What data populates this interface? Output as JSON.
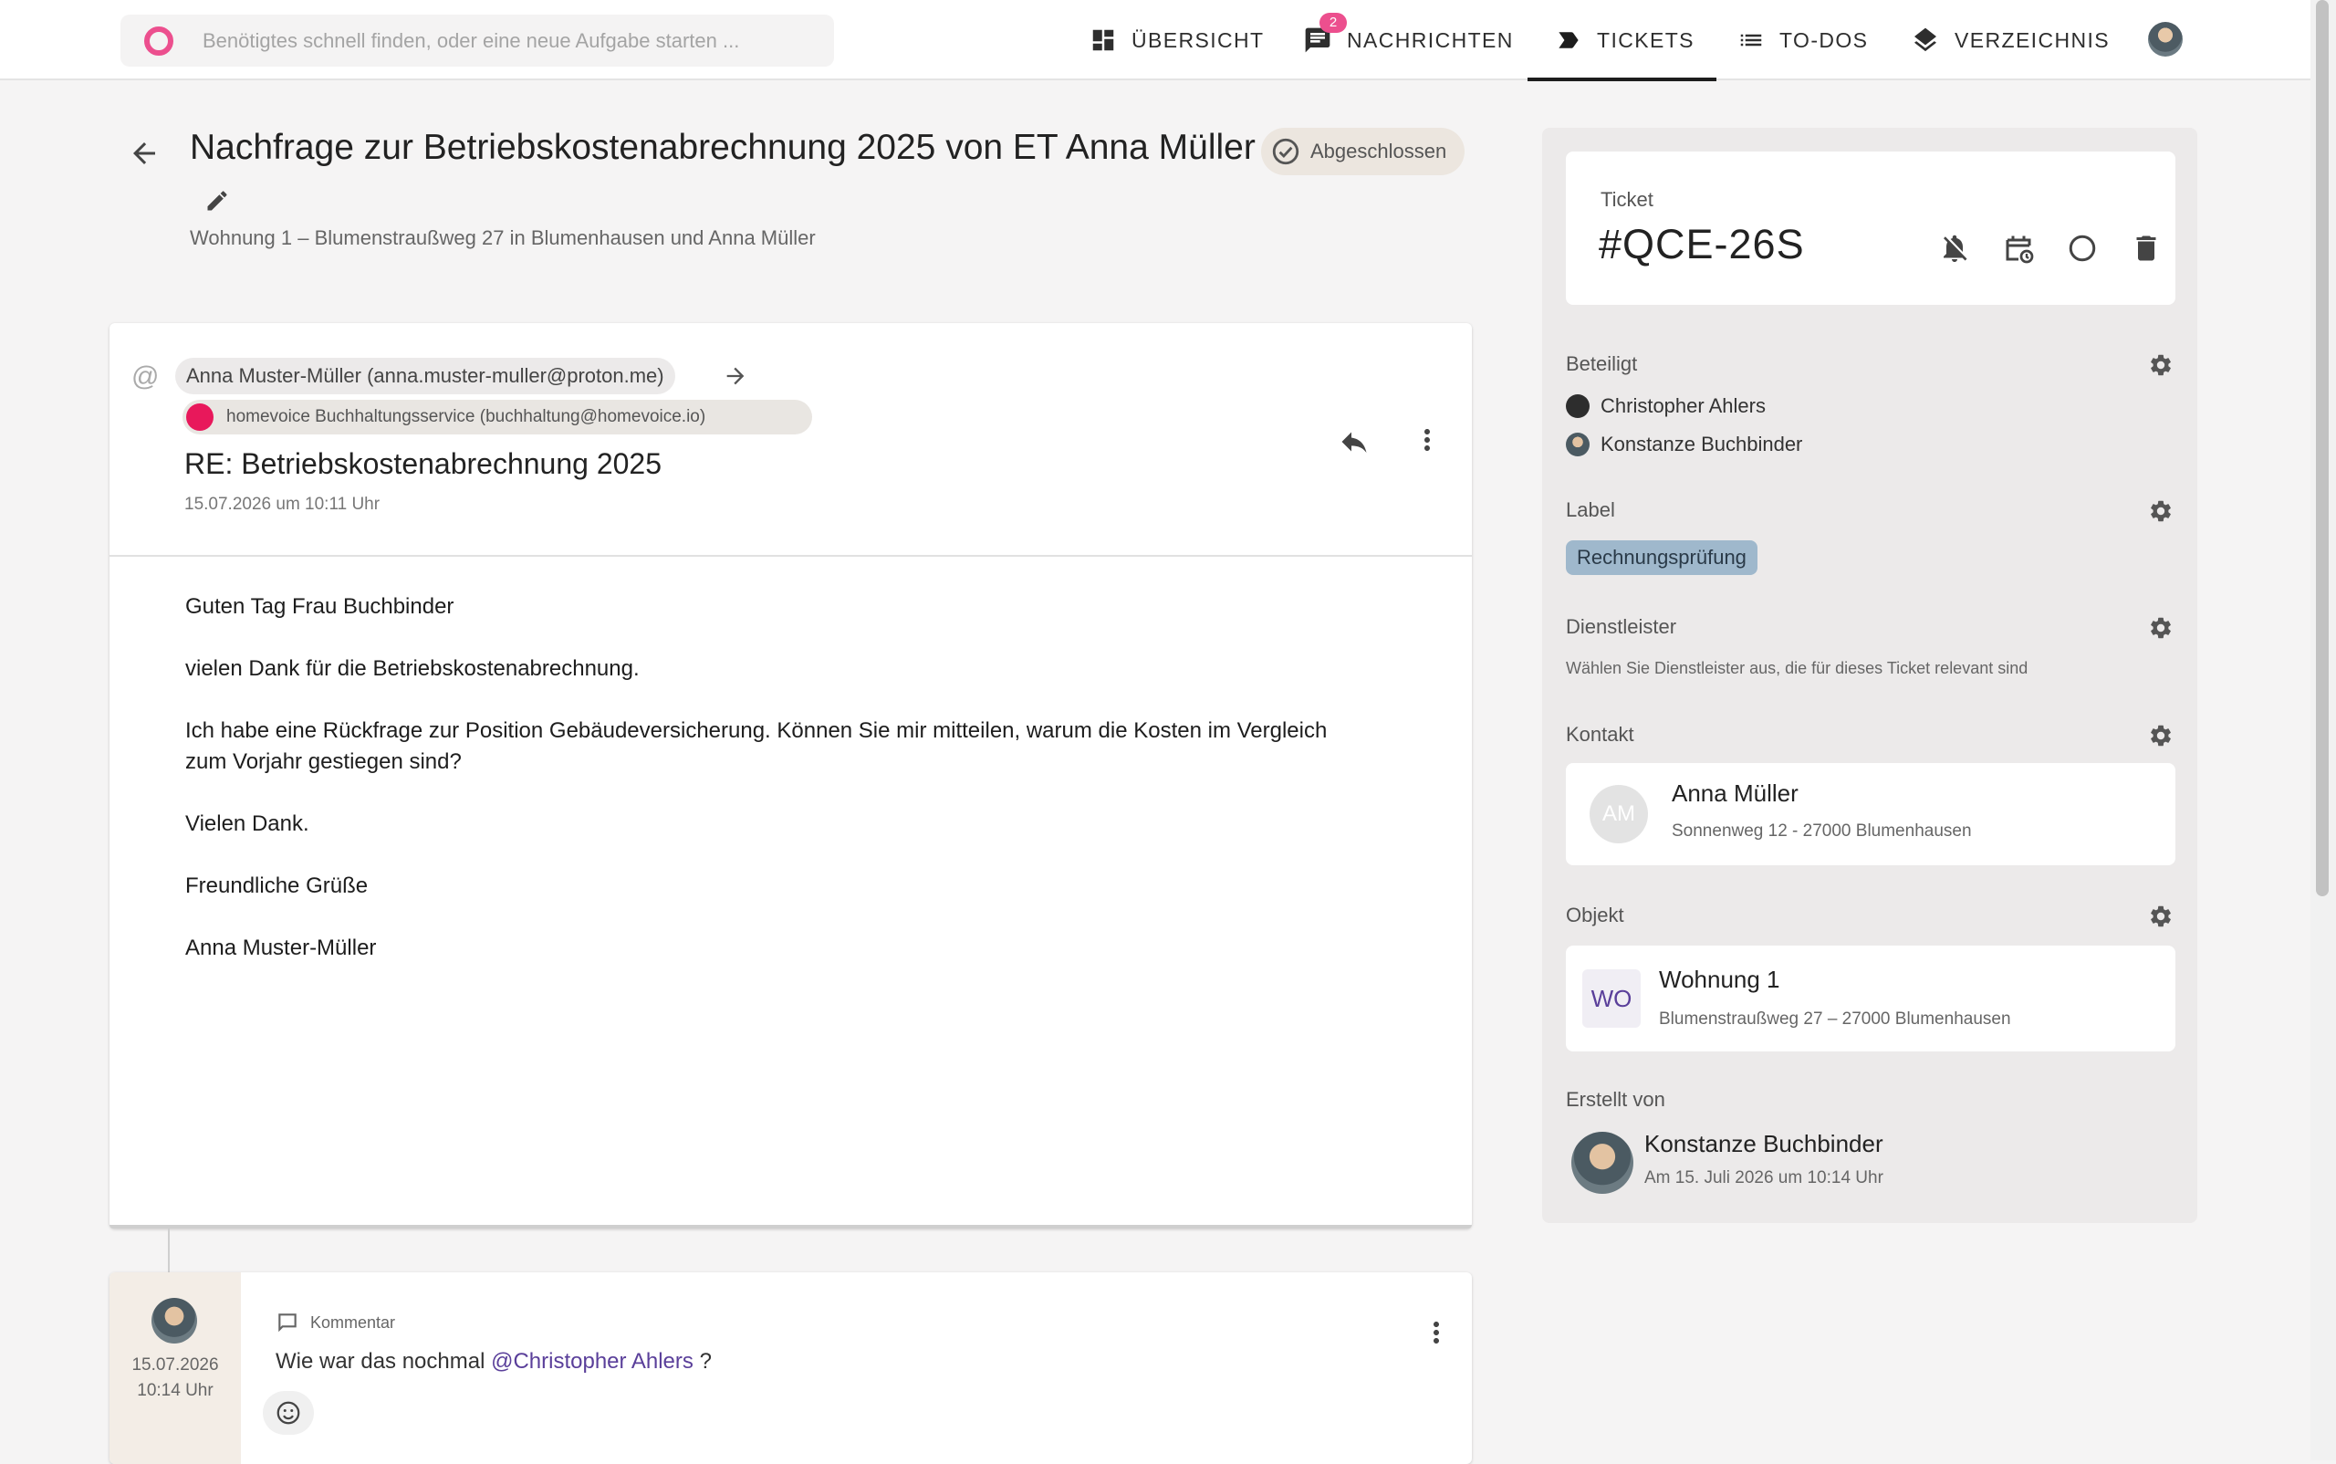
{
  "search": {
    "placeholder": "Benötigtes schnell finden, oder eine neue Aufgabe starten ..."
  },
  "nav": {
    "items": [
      {
        "label": "ÜBERSICHT",
        "icon": "dashboard-icon"
      },
      {
        "label": "NACHRICHTEN",
        "icon": "chat-icon",
        "badge": "2"
      },
      {
        "label": "TICKETS",
        "icon": "label-icon",
        "active": true
      },
      {
        "label": "TO-DOS",
        "icon": "list-icon"
      },
      {
        "label": "VERZEICHNIS",
        "icon": "layers-icon"
      }
    ]
  },
  "ticket": {
    "title": "Nachfrage zur Betriebskostenabrechnung 2025 von ET Anna Müller",
    "status": "Abgeschlossen",
    "subtitle": "Wohnung 1 – Blumenstraußweg 27 in Blumenhausen und Anna Müller"
  },
  "message": {
    "from": "Anna Muster-Müller (anna.muster-muller@proton.me)",
    "to": "homevoice Buchhaltungsservice (buchhaltung@homevoice.io)",
    "subject": "RE: Betriebskostenabrechnung 2025",
    "date": "15.07.2026 um 10:11 Uhr",
    "body": [
      "Guten Tag Frau Buchbinder",
      "vielen Dank für die Betriebskostenabrechnung.",
      "Ich habe eine Rückfrage zur Position Gebäudeversicherung. Können Sie mir mitteilen, warum die Kosten im Vergleich zum Vorjahr gestiegen sind?",
      "Vielen Dank.",
      "Freundliche Grüße",
      "Anna Muster-Müller"
    ]
  },
  "comment": {
    "date": "15.07.2026",
    "time": "10:14 Uhr",
    "type": "Kommentar",
    "text_before": "Wie war das nochmal",
    "mention": "@Christopher Ahlers",
    "text_after": "?"
  },
  "panel": {
    "ticket_label": "Ticket",
    "ticket_id": "#QCE-26S",
    "participants_title": "Beteiligt",
    "participants": [
      "Christopher Ahlers",
      "Konstanze Buchbinder"
    ],
    "label_title": "Label",
    "label": "Rechnungsprüfung",
    "label_color": "#9fb8cc",
    "providers_title": "Dienstleister",
    "providers_hint": "Wählen Sie Dienstleister aus, die für dieses Ticket relevant sind",
    "contact_title": "Kontakt",
    "contact": {
      "initials": "AM",
      "name": "Anna Müller",
      "address": "Sonnenweg 12 - 27000 Blumenhausen"
    },
    "object_title": "Objekt",
    "object": {
      "initials": "WO",
      "name": "Wohnung 1",
      "address": "Blumenstraußweg 27 – 27000 Blumenhausen"
    },
    "creator_title": "Erstellt von",
    "creator": {
      "name": "Konstanze Buchbinder",
      "date": "Am 15. Juli 2026 um 10:14 Uhr"
    }
  },
  "colors": {
    "accent": "#ec4f8e",
    "mention": "#5a3f9a",
    "status_chip": "#ece6df"
  }
}
